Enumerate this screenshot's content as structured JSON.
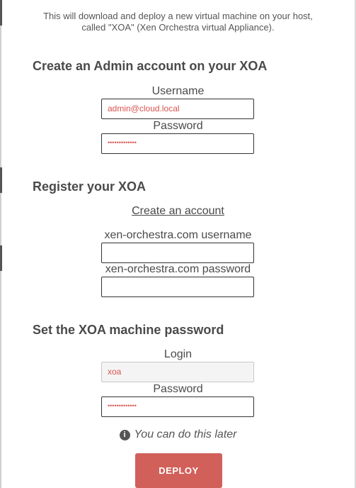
{
  "intro": {
    "line1": "This will download and deploy a new virtual machine on your host,",
    "line2": "called \"XOA\" (Xen Orchestra virtual Appliance)."
  },
  "admin_section": {
    "title": "Create an Admin account on your XOA",
    "username_label": "Username",
    "username_value": "admin@cloud.local",
    "password_label": "Password",
    "password_value": "•••••••••••••"
  },
  "register_section": {
    "title": "Register your XOA",
    "create_account_link": "Create an account",
    "xo_username_label": "xen-orchestra.com username",
    "xo_username_value": "",
    "xo_password_label": "xen-orchestra.com password",
    "xo_password_value": ""
  },
  "machine_section": {
    "title": "Set the XOA machine password",
    "login_label": "Login",
    "login_value": "xoa",
    "password_label": "Password",
    "password_value": "•••••••••••••"
  },
  "hint": {
    "icon": "info-circle-icon",
    "text": "You can do this later"
  },
  "deploy_button": {
    "label": "DEPLOY",
    "color": "#d1605a"
  }
}
